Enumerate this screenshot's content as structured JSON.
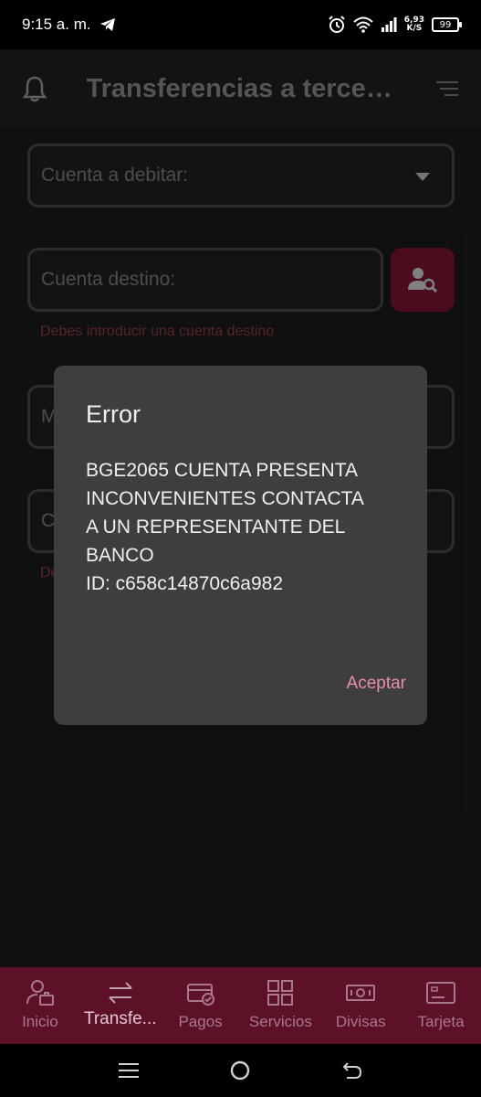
{
  "status_bar": {
    "time": "9:15 a. m.",
    "speed_value": "6,93",
    "speed_unit": "K/S",
    "battery": "99"
  },
  "header": {
    "title": "Transferencias a tercer..."
  },
  "form": {
    "debit_account_placeholder": "Cuenta a debitar:",
    "destination_placeholder": "Cuenta destino:",
    "destination_error": "Debes introducir una cuenta destino",
    "amount_peek": "M",
    "concept_peek": "C",
    "concept_error_peek": "De"
  },
  "dialog": {
    "title": "Error",
    "message": "BGE2065 CUENTA PRESENTA\nINCONVENIENTES  CONTACTA\nA UN REPRESENTANTE DEL\nBANCO\nID: c658c14870c6a982",
    "accept_label": "Aceptar"
  },
  "bottom_nav": {
    "items": [
      {
        "label": "Inicio",
        "icon": "home-person-icon"
      },
      {
        "label": "Transfe...",
        "icon": "transfer-arrows-icon"
      },
      {
        "label": "Pagos",
        "icon": "payment-card-icon"
      },
      {
        "label": "Servicios",
        "icon": "grid-icon"
      },
      {
        "label": "Divisas",
        "icon": "currency-bill-icon"
      },
      {
        "label": "Tarjeta",
        "icon": "card-icon"
      }
    ],
    "active_index": 1
  },
  "colors": {
    "accent": "#7a1530",
    "nav_background": "#5c1126",
    "error_text": "#8e3a3f",
    "dialog_action": "#e88fab"
  }
}
